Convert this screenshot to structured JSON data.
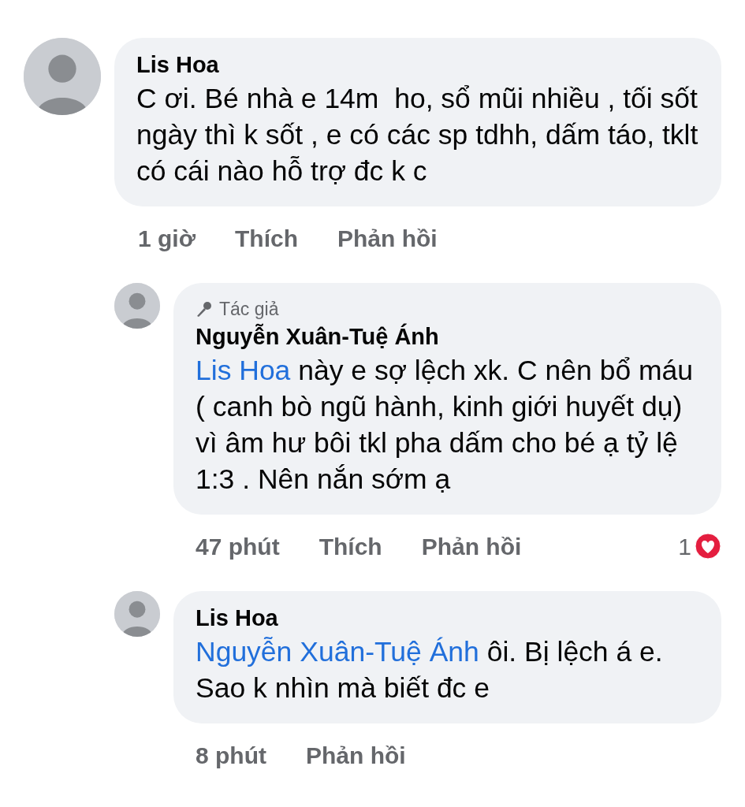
{
  "comments": [
    {
      "author": "Lis Hoa",
      "text": "C ơi. Bé nhà e 14m  ho, sổ mũi nhiều , tối sốt ngày thì k sốt , e có các sp tdhh, dấm táo, tklt có cái nào hỗ trợ đc k c",
      "time": "1 giờ",
      "actions": [
        "Thích",
        "Phản hồi"
      ],
      "replies": [
        {
          "author_badge": "Tác giả",
          "author": "Nguyễn Xuân-Tuệ Ánh",
          "mention": "Lis Hoa",
          "text": " này e sợ lệch xk. C nên bổ máu ( canh bò ngũ hành, kinh giới huyết dụ)  vì âm hư bôi tkl pha dấm cho bé ạ tỷ lệ 1:3 . Nên nắn sớm ạ",
          "time": "47 phút",
          "actions": [
            "Thích",
            "Phản hồi"
          ],
          "reaction_count": "1"
        },
        {
          "author": "Lis Hoa",
          "mention": "Nguyễn Xuân-Tuệ Ánh",
          "text": " ôi. Bị lệch á e. Sao k nhìn mà biết đc e",
          "time": "8 phút",
          "actions": [
            "Phản hồi"
          ]
        }
      ]
    }
  ]
}
